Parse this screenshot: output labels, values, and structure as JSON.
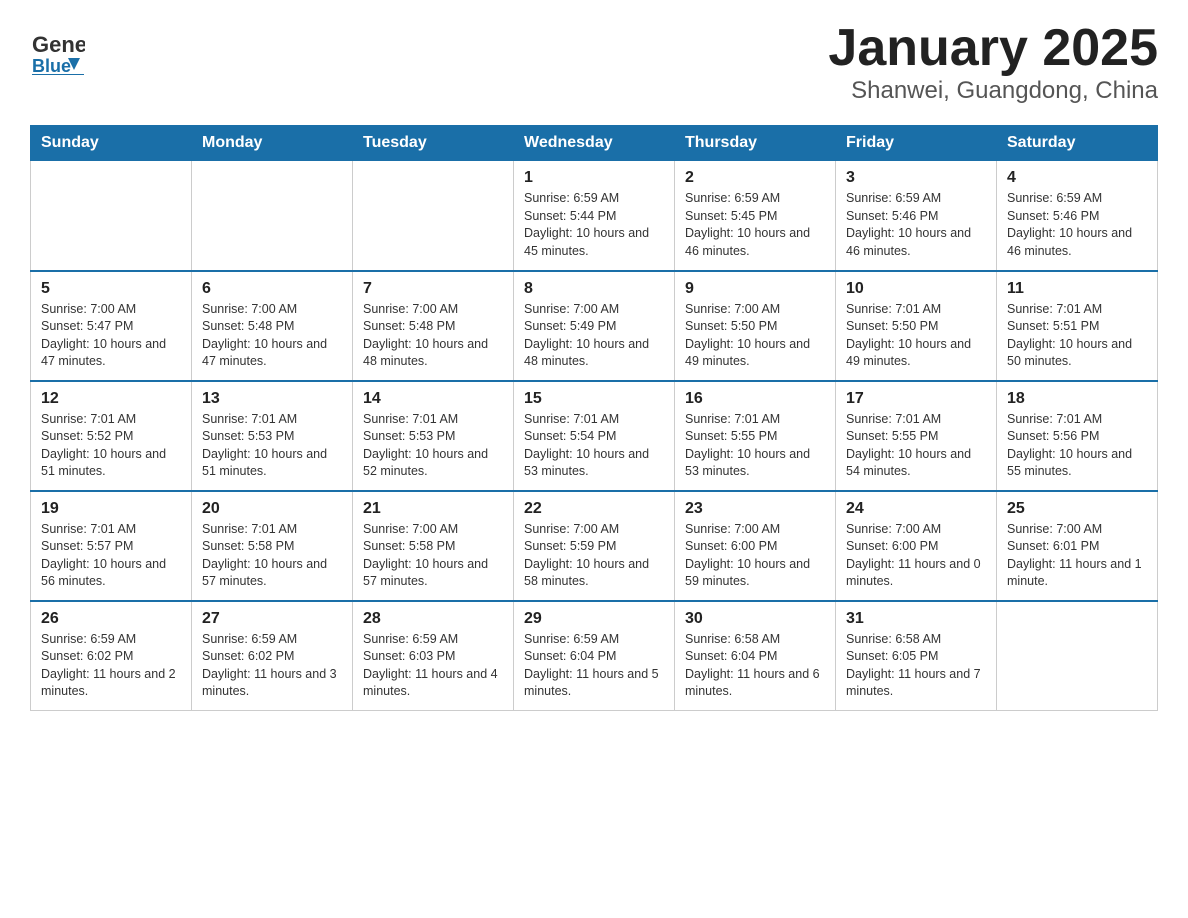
{
  "header": {
    "logo_general": "General",
    "logo_blue": "Blue",
    "title": "January 2025",
    "subtitle": "Shanwei, Guangdong, China"
  },
  "days_of_week": [
    "Sunday",
    "Monday",
    "Tuesday",
    "Wednesday",
    "Thursday",
    "Friday",
    "Saturday"
  ],
  "weeks": [
    [
      {
        "num": "",
        "info": ""
      },
      {
        "num": "",
        "info": ""
      },
      {
        "num": "",
        "info": ""
      },
      {
        "num": "1",
        "info": "Sunrise: 6:59 AM\nSunset: 5:44 PM\nDaylight: 10 hours and 45 minutes."
      },
      {
        "num": "2",
        "info": "Sunrise: 6:59 AM\nSunset: 5:45 PM\nDaylight: 10 hours and 46 minutes."
      },
      {
        "num": "3",
        "info": "Sunrise: 6:59 AM\nSunset: 5:46 PM\nDaylight: 10 hours and 46 minutes."
      },
      {
        "num": "4",
        "info": "Sunrise: 6:59 AM\nSunset: 5:46 PM\nDaylight: 10 hours and 46 minutes."
      }
    ],
    [
      {
        "num": "5",
        "info": "Sunrise: 7:00 AM\nSunset: 5:47 PM\nDaylight: 10 hours and 47 minutes."
      },
      {
        "num": "6",
        "info": "Sunrise: 7:00 AM\nSunset: 5:48 PM\nDaylight: 10 hours and 47 minutes."
      },
      {
        "num": "7",
        "info": "Sunrise: 7:00 AM\nSunset: 5:48 PM\nDaylight: 10 hours and 48 minutes."
      },
      {
        "num": "8",
        "info": "Sunrise: 7:00 AM\nSunset: 5:49 PM\nDaylight: 10 hours and 48 minutes."
      },
      {
        "num": "9",
        "info": "Sunrise: 7:00 AM\nSunset: 5:50 PM\nDaylight: 10 hours and 49 minutes."
      },
      {
        "num": "10",
        "info": "Sunrise: 7:01 AM\nSunset: 5:50 PM\nDaylight: 10 hours and 49 minutes."
      },
      {
        "num": "11",
        "info": "Sunrise: 7:01 AM\nSunset: 5:51 PM\nDaylight: 10 hours and 50 minutes."
      }
    ],
    [
      {
        "num": "12",
        "info": "Sunrise: 7:01 AM\nSunset: 5:52 PM\nDaylight: 10 hours and 51 minutes."
      },
      {
        "num": "13",
        "info": "Sunrise: 7:01 AM\nSunset: 5:53 PM\nDaylight: 10 hours and 51 minutes."
      },
      {
        "num": "14",
        "info": "Sunrise: 7:01 AM\nSunset: 5:53 PM\nDaylight: 10 hours and 52 minutes."
      },
      {
        "num": "15",
        "info": "Sunrise: 7:01 AM\nSunset: 5:54 PM\nDaylight: 10 hours and 53 minutes."
      },
      {
        "num": "16",
        "info": "Sunrise: 7:01 AM\nSunset: 5:55 PM\nDaylight: 10 hours and 53 minutes."
      },
      {
        "num": "17",
        "info": "Sunrise: 7:01 AM\nSunset: 5:55 PM\nDaylight: 10 hours and 54 minutes."
      },
      {
        "num": "18",
        "info": "Sunrise: 7:01 AM\nSunset: 5:56 PM\nDaylight: 10 hours and 55 minutes."
      }
    ],
    [
      {
        "num": "19",
        "info": "Sunrise: 7:01 AM\nSunset: 5:57 PM\nDaylight: 10 hours and 56 minutes."
      },
      {
        "num": "20",
        "info": "Sunrise: 7:01 AM\nSunset: 5:58 PM\nDaylight: 10 hours and 57 minutes."
      },
      {
        "num": "21",
        "info": "Sunrise: 7:00 AM\nSunset: 5:58 PM\nDaylight: 10 hours and 57 minutes."
      },
      {
        "num": "22",
        "info": "Sunrise: 7:00 AM\nSunset: 5:59 PM\nDaylight: 10 hours and 58 minutes."
      },
      {
        "num": "23",
        "info": "Sunrise: 7:00 AM\nSunset: 6:00 PM\nDaylight: 10 hours and 59 minutes."
      },
      {
        "num": "24",
        "info": "Sunrise: 7:00 AM\nSunset: 6:00 PM\nDaylight: 11 hours and 0 minutes."
      },
      {
        "num": "25",
        "info": "Sunrise: 7:00 AM\nSunset: 6:01 PM\nDaylight: 11 hours and 1 minute."
      }
    ],
    [
      {
        "num": "26",
        "info": "Sunrise: 6:59 AM\nSunset: 6:02 PM\nDaylight: 11 hours and 2 minutes."
      },
      {
        "num": "27",
        "info": "Sunrise: 6:59 AM\nSunset: 6:02 PM\nDaylight: 11 hours and 3 minutes."
      },
      {
        "num": "28",
        "info": "Sunrise: 6:59 AM\nSunset: 6:03 PM\nDaylight: 11 hours and 4 minutes."
      },
      {
        "num": "29",
        "info": "Sunrise: 6:59 AM\nSunset: 6:04 PM\nDaylight: 11 hours and 5 minutes."
      },
      {
        "num": "30",
        "info": "Sunrise: 6:58 AM\nSunset: 6:04 PM\nDaylight: 11 hours and 6 minutes."
      },
      {
        "num": "31",
        "info": "Sunrise: 6:58 AM\nSunset: 6:05 PM\nDaylight: 11 hours and 7 minutes."
      },
      {
        "num": "",
        "info": ""
      }
    ]
  ]
}
